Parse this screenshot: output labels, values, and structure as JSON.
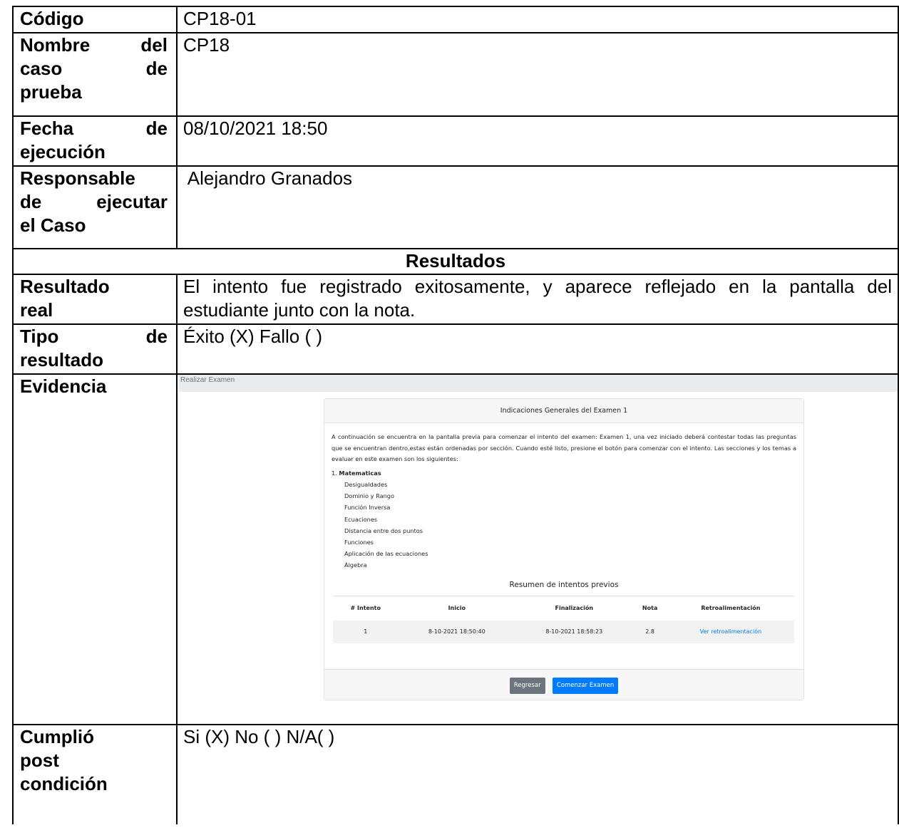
{
  "rows": {
    "codigo": {
      "label": "Código",
      "value": "CP18-01"
    },
    "nombre": {
      "label_lines": [
        "Nombre del",
        "caso de",
        "prueba"
      ],
      "value": "CP18"
    },
    "fecha": {
      "label_lines": [
        "Fecha de",
        "ejecución"
      ],
      "value": "08/10/2021 18:50"
    },
    "responsable": {
      "label_lines": [
        "Responsable",
        "de ejecutar",
        "el Caso"
      ],
      "value": " Alejandro Granados"
    },
    "resultados_header": "Resultados",
    "resultado_real": {
      "label_lines": [
        "Resultado",
        "real"
      ],
      "value": "El intento fue registrado exitosamente, y aparece reflejado en la pantalla del estudiante junto con la nota."
    },
    "tipo": {
      "label_lines": [
        "Tipo de",
        "resultado"
      ],
      "value": "Éxito (X) Fallo ( )"
    },
    "evidencia": {
      "label": "Evidencia"
    },
    "cumplio": {
      "label_lines": [
        "Cumplió",
        "post",
        "condición"
      ],
      "value": "Si (X) No ( ) N/A( )"
    }
  },
  "screenshot": {
    "top_bar": "Realizar Examen",
    "card_title": "Indicaciones Generales del Examen 1",
    "intro": "A continuación se encuentra en la pantalla previa para comenzar el intento del examen: Examen 1, una vez iniciado deberá contestar todas las preguntas que se encuentran dentro,estas están ordenadas por sección. Cuando esté listo, presione el botón para comenzar con el intento. Las secciones y los temas a evaluar en este examen son los siguientes:",
    "section_number": "1.",
    "section_name": "Matematicas",
    "topics": [
      "Desigualdades",
      "Dominio y Rango",
      "Función Inversa",
      "Ecuaciones",
      "Distancia entre dos puntos",
      "Funciones",
      "Aplicación de las ecuaciones",
      "Álgebra"
    ],
    "summary_title": "Resumen de intentos previos",
    "columns": [
      "# Intento",
      "Inicio",
      "Finalización",
      "Nota",
      "Retroalimentación"
    ],
    "attempts": [
      {
        "n": "1",
        "start": "8-10-2021 18:50:40",
        "end": "8-10-2021 18:58:23",
        "grade": "2.8",
        "feedback": "Ver retroalimentación"
      }
    ],
    "buttons": {
      "back": "Regresar",
      "start": "Comenzar Examen"
    }
  }
}
